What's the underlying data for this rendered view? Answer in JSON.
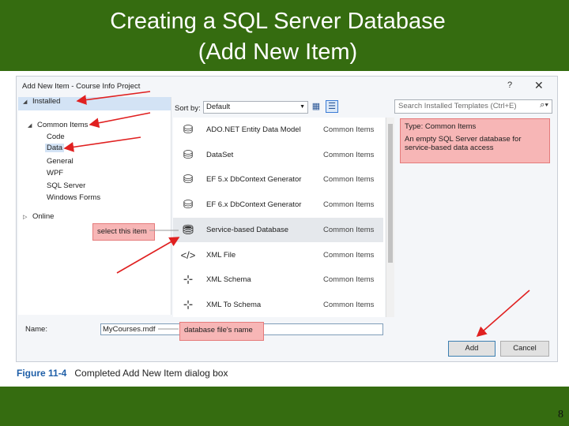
{
  "slide": {
    "title_line1": "Creating a SQL Server Database",
    "title_line2": "(Add New Item)",
    "page_number": "8"
  },
  "dialog": {
    "title": "Add New Item - Course Info Project",
    "help": "?",
    "close": "✕",
    "tree": {
      "installed": "Installed",
      "common_items": "Common Items",
      "children": [
        "Code",
        "Data",
        "General",
        "WPF",
        "SQL Server",
        "Windows Forms"
      ],
      "online": "Online"
    },
    "sort_by_label": "Sort by:",
    "sort_by_value": "Default",
    "search_placeholder": "Search Installed Templates (Ctrl+E)",
    "templates": [
      {
        "name": "ADO.NET Entity Data Model",
        "category": "Common Items",
        "icon": "entity-model-icon"
      },
      {
        "name": "DataSet",
        "category": "Common Items",
        "icon": "dataset-icon"
      },
      {
        "name": "EF 5.x DbContext Generator",
        "category": "Common Items",
        "icon": "ef-generator-icon"
      },
      {
        "name": "EF 6.x DbContext Generator",
        "category": "Common Items",
        "icon": "ef-generator-icon"
      },
      {
        "name": "Service-based Database",
        "category": "Common Items",
        "icon": "database-icon",
        "selected": true
      },
      {
        "name": "XML File",
        "category": "Common Items",
        "icon": "xml-file-icon"
      },
      {
        "name": "XML Schema",
        "category": "Common Items",
        "icon": "xml-schema-icon"
      },
      {
        "name": "XML To Schema",
        "category": "Common Items",
        "icon": "xml-schema-icon"
      }
    ],
    "info": {
      "type": "Type:  Common Items",
      "description": "An empty SQL Server database for service-based data access"
    },
    "name_label": "Name:",
    "name_value": "MyCourses.mdf",
    "add_button": "Add",
    "cancel_button": "Cancel"
  },
  "callouts": {
    "select_item": "select this item",
    "file_name": "database file's name"
  },
  "caption": {
    "figure": "Figure 11-4",
    "text": "Completed Add New Item dialog box"
  },
  "colors": {
    "band": "#356c10",
    "callout_fill": "#f7b6b6",
    "arrow": "#e02020"
  }
}
